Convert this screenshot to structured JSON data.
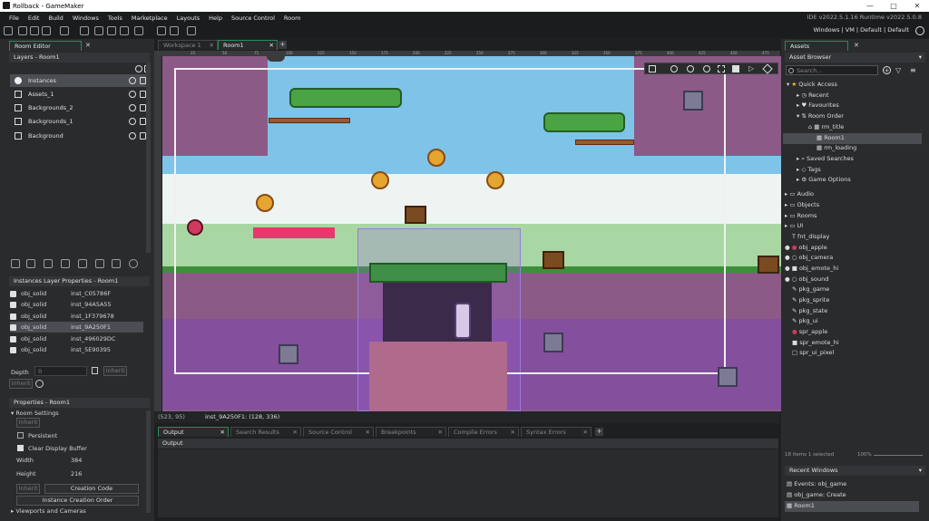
{
  "window": {
    "title": "Rollback - GameMaker",
    "ide_version": "IDE v2022.5.1.16  Runtime v2022.5.0.8",
    "target": "Windows | VM | Default | Default"
  },
  "menu": [
    "File",
    "Edit",
    "Build",
    "Windows",
    "Tools",
    "Marketplace",
    "Layouts",
    "Help",
    "Source Control",
    "Room"
  ],
  "room_editor": {
    "tab": "Room Editor",
    "layers_title": "Layers - Room1",
    "layers": [
      "Instances",
      "Assets_1",
      "Backgrounds_2",
      "Backgrounds_1",
      "Background"
    ],
    "instances_title": "Instances Layer Properties - Room1",
    "instances": [
      [
        "obj_solid",
        "inst_C05786F"
      ],
      [
        "obj_solid",
        "inst_94A5A55"
      ],
      [
        "obj_solid",
        "inst_1F379678"
      ],
      [
        "obj_solid",
        "inst_9A250F1"
      ],
      [
        "obj_solid",
        "inst_496029DC"
      ],
      [
        "obj_solid",
        "inst_5E90395"
      ]
    ],
    "depth_label": "Depth",
    "depth_value": "0",
    "inherit": "Inherit",
    "props_title": "Properties - Room1",
    "room_settings": "Room Settings",
    "persistent": "Persistent",
    "clear_buffer": "Clear Display Buffer",
    "width_label": "Width",
    "width_value": "384",
    "height_label": "Height",
    "height_value": "216",
    "creation_code": "Creation Code",
    "instance_order": "Instance Creation Order",
    "viewports": "Viewports and Cameras"
  },
  "workspace": {
    "tabs": [
      "Workspace 1",
      "Room1"
    ],
    "ruler": [
      "25",
      "50",
      "75",
      "100",
      "125",
      "150",
      "175",
      "200",
      "225",
      "250",
      "275",
      "300",
      "325",
      "350",
      "375",
      "400",
      "425",
      "450",
      "475"
    ],
    "coords": "(523, 95)",
    "selected": "inst_9A250F1: (128, 336)"
  },
  "output": {
    "tabs": [
      "Output",
      "Search Results",
      "Source Control",
      "Breakpoints",
      "Compile Errors",
      "Syntax Errors"
    ],
    "label": "Output"
  },
  "assets": {
    "tab": "Assets",
    "browser": "Asset Browser",
    "search_placeholder": "Search...",
    "quick": "Quick Access",
    "recent": "Recent",
    "favourites": "Favourites",
    "room_order": "Room Order",
    "rooms_order": [
      "rm_title",
      "Room1",
      "rm_loading"
    ],
    "saved": "Saved Searches",
    "tags": "Tags",
    "game_options": "Game Options",
    "groups": [
      "Audio",
      "Objects",
      "Rooms",
      "UI"
    ],
    "items": [
      "fnt_display",
      "obj_apple",
      "obj_camera",
      "obj_emote_hi",
      "obj_sound",
      "pkg_game",
      "pkg_sprite",
      "pkg_state",
      "pkg_ui",
      "spr_apple",
      "spr_emote_hi",
      "spr_ui_pixel"
    ],
    "footer_count": "18 items   1 selected",
    "zoom": "100%",
    "recent_title": "Recent Windows",
    "recent_windows": [
      "Events: obj_game",
      "obj_game: Create",
      "Room1"
    ]
  },
  "colors": {
    "accent": "#2d8a5a",
    "selection": "#4a4d52",
    "sky": "#7ec3e8",
    "dirt": "#8b5a86"
  }
}
